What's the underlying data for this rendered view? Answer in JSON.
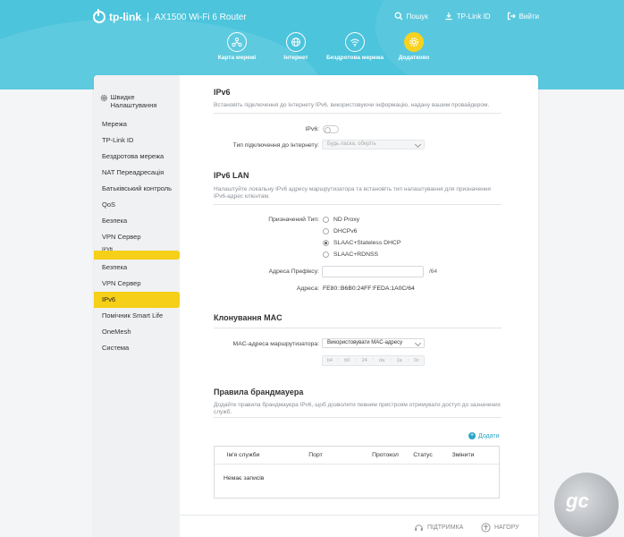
{
  "header": {
    "brand": "tp-link",
    "separator": "|",
    "model": "AX1500 Wi-Fi 6 Router",
    "links": [
      {
        "label": "Пошук",
        "icon": "search-icon"
      },
      {
        "label": "TP-Link ID",
        "icon": "download-icon"
      },
      {
        "label": "Вийти",
        "icon": "logout-icon"
      }
    ],
    "tabs": [
      {
        "label": "Карта мережі",
        "icon": "network-map-icon"
      },
      {
        "label": "Інтернет",
        "icon": "globe-icon"
      },
      {
        "label": "Бездротова мережа",
        "icon": "wifi-icon"
      },
      {
        "label": "Додатково",
        "icon": "gear-icon",
        "active": true
      }
    ],
    "accent": "#4bc4dc",
    "active_color": "#f7d21f"
  },
  "sidebar": {
    "head": "Швидке Налаштування",
    "items": [
      {
        "label": "Мережа"
      },
      {
        "label": "TP-Link ID"
      },
      {
        "label": "Бездротова мережа"
      },
      {
        "label": "NAT Переадресація"
      },
      {
        "label": "Батьківський контроль"
      },
      {
        "label": "QoS"
      },
      {
        "label": "Безпека"
      },
      {
        "label": "VPN Сервер"
      },
      {
        "label": "IPv6"
      },
      {
        "label": "Безпека"
      },
      {
        "label": "VPN Сервер"
      },
      {
        "label": "IPv6"
      },
      {
        "label": "Помічник Smart Life"
      },
      {
        "label": "OneMesh"
      },
      {
        "label": "Система"
      }
    ]
  },
  "ipv6": {
    "title": "IPv6",
    "desc": "Встановіть підключення до Інтернету IPv6, використовуючи інформацію, надану вашим провайдером.",
    "toggle_label": "IPv6:",
    "conn_type_label": "Тип підключення до Інтернету:",
    "conn_type_placeholder": "Будь ласка, оберіть"
  },
  "lan": {
    "title": "IPv6 LAN",
    "desc": "Налаштуйте локальну IPv6 адресу маршрутизатора та встановіть тип налаштування для призначення IPv6-адрес клієнтам.",
    "assign_label": "Призначений Тип:",
    "options": [
      {
        "label": "ND Proxy",
        "checked": false
      },
      {
        "label": "DHCPv6",
        "checked": false
      },
      {
        "label": "SLAAC+Stateless DHCP",
        "checked": true
      },
      {
        "label": "SLAAC+RDNSS",
        "checked": false
      }
    ],
    "prefix_label": "Адреса Префіксу:",
    "prefix_value": "",
    "prefix_suffix": "/64",
    "address_label": "Адреса:",
    "address_value": "FE80::B6B0:24FF:FEDA:1A0C/64"
  },
  "mac": {
    "title": "Клонування MAC",
    "label": "MAC-адреса маршрутизатора:",
    "select_value": "Використовувати MAC-адресу",
    "octets": [
      "b4",
      "b0",
      "24",
      "da",
      "1a",
      "0c"
    ],
    "separator": ":"
  },
  "firewall": {
    "title": "Правила брандмауера",
    "desc": "Додайте правила брандмауера IPv6, щоб дозволити певним пристроям отримувати доступ до зазначених служб.",
    "add_label": "Додати",
    "columns": [
      "Ім'я служби",
      "Порт",
      "Протокол",
      "Статус",
      "Змінити"
    ],
    "empty": "Немає записів"
  },
  "footer": {
    "support": "ПІДТРИМКА",
    "top": "НАГОРУ"
  },
  "watermark": "gc"
}
